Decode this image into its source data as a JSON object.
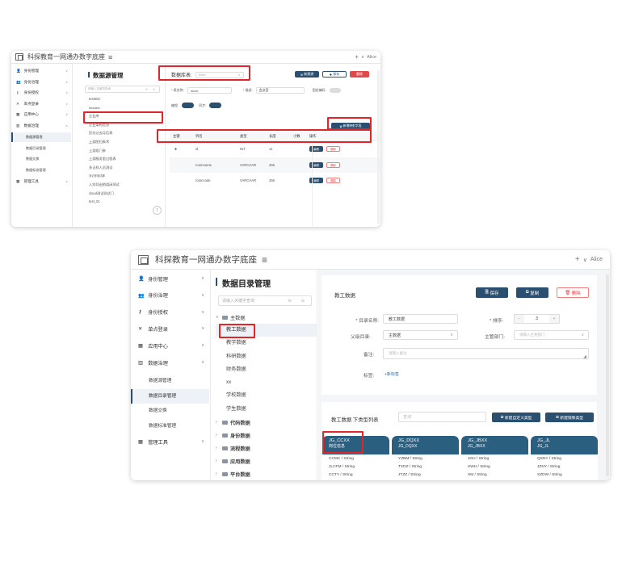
{
  "app": {
    "title": "科探教育一网通办数字底座",
    "menu_icon": "≡",
    "user_plus": "+",
    "user_caret": "∨",
    "user_name": "Alice"
  },
  "nav": [
    {
      "label": "身份管理",
      "icon": "user-icon",
      "glyph": "👤",
      "caret": "∨"
    },
    {
      "label": "身份治理",
      "icon": "users-icon",
      "glyph": "👥",
      "caret": "∨"
    },
    {
      "label": "身份授权",
      "icon": "key-icon",
      "glyph": "⚷",
      "caret": "∨"
    },
    {
      "label": "单点登录",
      "icon": "sso-icon",
      "glyph": "✕",
      "caret": "∨"
    },
    {
      "label": "应用中心",
      "icon": "apps-icon",
      "glyph": "▦",
      "caret": "∨"
    },
    {
      "label": "数据治理",
      "icon": "chart-icon",
      "glyph": "▥",
      "caret": "∧"
    }
  ],
  "nav_sub": [
    "数据源管理",
    "数据目录管理",
    "数据交换",
    "数据标准管理"
  ],
  "nav_last": {
    "label": "管理工具",
    "icon": "tools-icon",
    "glyph": "▦",
    "caret": "∨"
  },
  "w1": {
    "section_title": "数据源管理",
    "filter_placeholder": "请输入关键词查询",
    "list": [
      "test003",
      "Newbase",
      "企业库",
      "企业架构信息",
      "民办过去月后表",
      "上游图归表术",
      "上游组门参",
      "上游服务里过程表",
      "多记样人员测试",
      "多记样测试脚",
      "入别导出稍组闭测试",
      "cloud测试测试门",
      "test_01"
    ],
    "db_label": "数据库表:",
    "db_placeholder": "enter",
    "btn_add": "新建源",
    "btn_save": "保存",
    "btn_delete": "删除",
    "table_label": "* 表名称:",
    "table_value": "room",
    "desc_label": "* 描述:",
    "desc_value": "会议室",
    "auto_label": "固定编码:",
    "inc_label": "编程:",
    "sync_label": "同步:",
    "add_field_btn": "新增映射字段",
    "columns": [
      "主键",
      "列名",
      "类型",
      "长度",
      "小数",
      "操作"
    ],
    "rows": [
      {
        "pk": "●",
        "name": "id",
        "type": "INT",
        "length": "11",
        "edit": "编辑",
        "del": "删除"
      },
      {
        "pk": "",
        "name": "roomname",
        "type": "VARCHAR",
        "length": "255",
        "edit": "编辑",
        "del": "删除"
      },
      {
        "pk": "",
        "name": "roomcode",
        "type": "VARCHAR",
        "length": "255",
        "edit": "编辑",
        "del": "删除"
      }
    ]
  },
  "w2": {
    "section_title": "数据目录管理",
    "filter_placeholder": "请输入关键字查询",
    "tree_root": "主数据",
    "tree_items": [
      "教工数据",
      "教学数据",
      "科研数据",
      "财务数据",
      "xx",
      "学校数据",
      "学生数据"
    ],
    "tree_folders": [
      "代码数据",
      "身份数据",
      "流程数据",
      "应用数据",
      "平台数据"
    ],
    "form_title": "教工数据",
    "btn_save": "保存",
    "btn_copy": "复制",
    "btn_delete": "删除",
    "f_name_label": "* 目录名称:",
    "f_name_value": "教工数据",
    "f_sort_label": "* 排序:",
    "f_sort_minus": "−",
    "f_sort_value": "3",
    "f_sort_plus": "+",
    "f_parent_label": "父级目录:",
    "f_parent_value": "主数据",
    "f_dept_label": "主管部门:",
    "f_dept_placeholder": "请输入主管部门",
    "f_note_label": "备注:",
    "f_note_placeholder": "请输入备注",
    "f_tag_label": "标签:",
    "f_tag_add": "+新标签",
    "list_title": "教工数据 下类型列表",
    "search_placeholder": "查询",
    "btn_new_def": "新建自定义类型",
    "btn_new_mirror": "新建镜像类型",
    "cards": [
      {
        "code": "JG_CCXX",
        "name": "岗位信息",
        "fields": [
          "CCMC / String",
          "JLCFM / String",
          "CCTY / String"
        ]
      },
      {
        "code": "JG_DQXX",
        "name": "JG_DQXX",
        "fields": [
          "YZBM / String",
          "TXDZ / String",
          "JTZZ / String"
        ]
      },
      {
        "code": "JG_JBXX",
        "name": "JG_JBXX",
        "fields": [
          "JGH / String",
          "SWH / String",
          "XM / String"
        ]
      },
      {
        "code": "JG_JL",
        "name": "JG_JL",
        "fields": [
          "QSNY / String",
          "JZNY / String",
          "SZDW / String"
        ]
      }
    ]
  },
  "colors": {
    "accent": "#2b4f6e",
    "highlight": "#e0262b",
    "card_header": "#2b5f7f"
  }
}
